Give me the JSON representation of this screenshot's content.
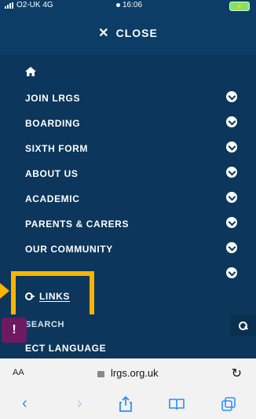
{
  "status": {
    "carrier": "O2-UK 4G",
    "time": "16:06",
    "battery": "charging"
  },
  "header": {
    "close_label": "CLOSE"
  },
  "nav": {
    "items": [
      {
        "label": "JOIN LRGS"
      },
      {
        "label": "BOARDING"
      },
      {
        "label": "SIXTH FORM"
      },
      {
        "label": "ABOUT US"
      },
      {
        "label": "ACADEMIC"
      },
      {
        "label": "PARENTS & CARERS"
      },
      {
        "label": "OUR COMMUNITY"
      }
    ],
    "links_label": "LINKS"
  },
  "search": {
    "label": "SEARCH"
  },
  "language": {
    "label": "ECT LANGUAGE"
  },
  "address_bar": {
    "aa_label": "AA",
    "url": "lrgs.org.uk"
  },
  "colors": {
    "nav_bg": "#0c365b",
    "accent": "#f7b500",
    "alert": "#6e1a62"
  }
}
